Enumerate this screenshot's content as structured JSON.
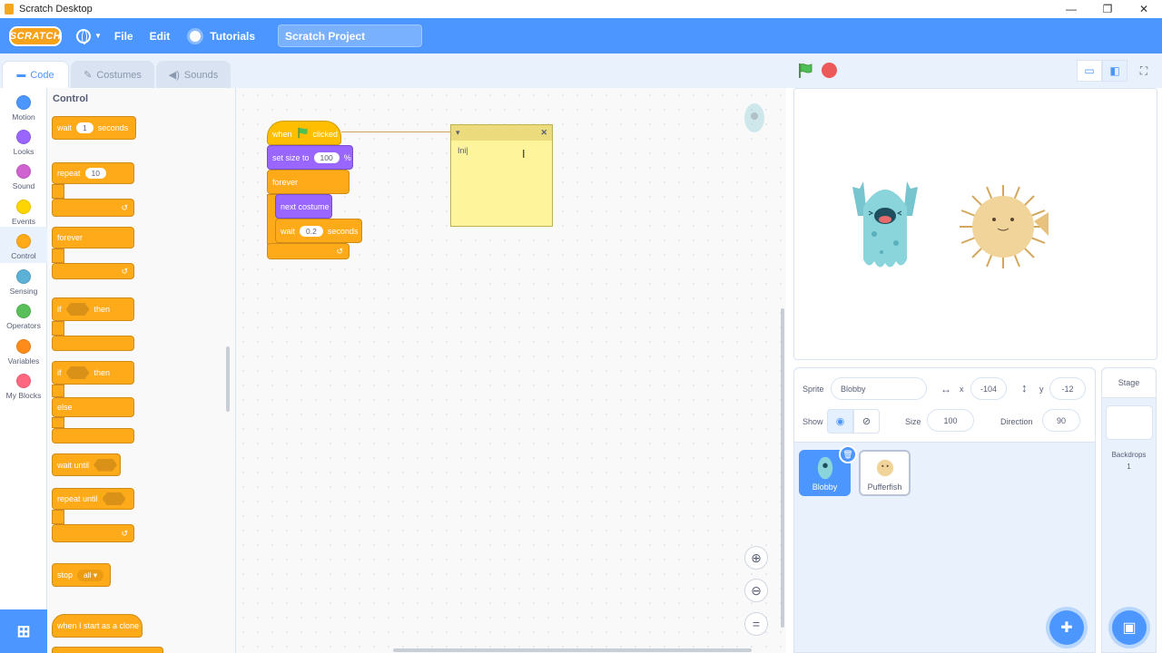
{
  "window": {
    "title": "Scratch Desktop",
    "controls": [
      "—",
      "❐",
      "✕"
    ]
  },
  "menubar": {
    "logo": "SCRATCH",
    "language_icon": "globe-icon",
    "file": "File",
    "edit": "Edit",
    "tutorials": "Tutorials",
    "project_title": "Scratch Project"
  },
  "tabs": {
    "code": "Code",
    "costumes": "Costumes",
    "sounds": "Sounds"
  },
  "categories": [
    {
      "label": "Motion",
      "color": "#4c97ff"
    },
    {
      "label": "Looks",
      "color": "#9966ff"
    },
    {
      "label": "Sound",
      "color": "#cf63cf"
    },
    {
      "label": "Events",
      "color": "#ffd500"
    },
    {
      "label": "Control",
      "color": "#ffab19"
    },
    {
      "label": "Sensing",
      "color": "#5cb1d6"
    },
    {
      "label": "Operators",
      "color": "#59c059"
    },
    {
      "label": "Variables",
      "color": "#ff8c1a"
    },
    {
      "label": "My Blocks",
      "color": "#ff6680"
    }
  ],
  "palette": {
    "title": "Control",
    "wait": "wait",
    "wait_value": "1",
    "seconds": "seconds",
    "repeat": "repeat",
    "repeat_value": "10",
    "forever": "forever",
    "if": "if",
    "then": "then",
    "if2": "if",
    "then2": "then",
    "else": "else",
    "wait_until": "wait until",
    "repeat_until": "repeat until",
    "stop": "stop",
    "stop_value": "all",
    "clone": "when I start as a clone"
  },
  "script": {
    "when": "when",
    "clicked": "clicked",
    "set_size": "set size to",
    "size_value": "100",
    "percent": "%",
    "forever": "forever",
    "next_costume": "next costume",
    "wait": "wait",
    "wait_value": "0.2",
    "seconds": "seconds"
  },
  "comment": {
    "text": "Ini|"
  },
  "sprite_info": {
    "sprite_label": "Sprite",
    "sprite_name": "Blobby",
    "x_label": "x",
    "x_value": "-104",
    "y_label": "y",
    "y_value": "-12",
    "show_label": "Show",
    "size_label": "Size",
    "size_value": "100",
    "direction_label": "Direction",
    "direction_value": "90"
  },
  "sprites": [
    {
      "name": "Blobby",
      "selected": true
    },
    {
      "name": "Pufferfish",
      "selected": false
    }
  ],
  "stage_pane": {
    "title": "Stage",
    "backdrops_label": "Backdrops",
    "backdrops_count": "1"
  },
  "colors": {
    "accent": "#4c97ff",
    "control": "#ffab19",
    "looks": "#9966ff",
    "events": "#ffbf00"
  }
}
